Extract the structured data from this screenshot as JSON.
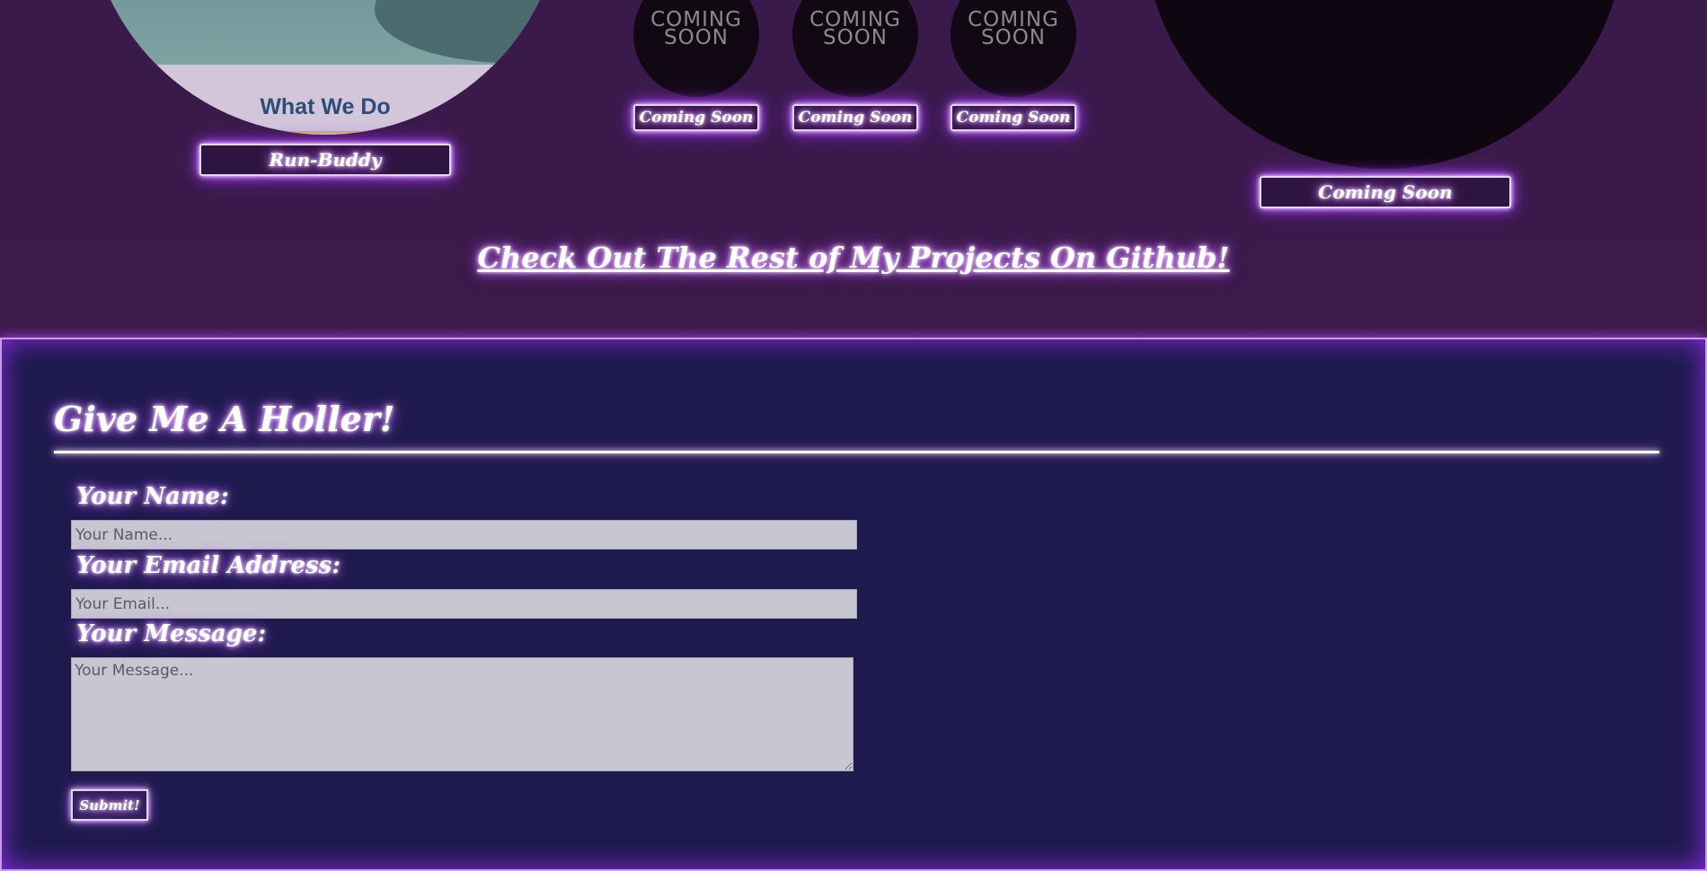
{
  "projects": {
    "featured": {
      "caption": "What We Do",
      "button_label": "Run-Buddy"
    },
    "coming_soon_items": [
      {
        "image_text_line1": "COMING",
        "image_text_line2": "SOON",
        "button_label": "Coming Soon"
      },
      {
        "image_text_line1": "COMING",
        "image_text_line2": "SOON",
        "button_label": "Coming Soon"
      },
      {
        "image_text_line1": "COMING",
        "image_text_line2": "SOON",
        "button_label": "Coming Soon"
      }
    ],
    "large_placeholder": {
      "button_label": "Coming Soon"
    },
    "github_link_text": "Check Out The Rest of My Projects On Github!"
  },
  "contact": {
    "title": "Give Me A Holler!",
    "name_label": "Your Name:",
    "name_placeholder": "Your Name...",
    "email_label": "Your Email Address:",
    "email_placeholder": "Your Email...",
    "message_label": "Your Message:",
    "message_placeholder": "Your Message...",
    "submit_label": "Submit!"
  },
  "colors": {
    "top_background": "#3a1a4a",
    "contact_background": "#1f1a4e",
    "glow": "#b04dff",
    "input_background": "#c8c6d2"
  }
}
